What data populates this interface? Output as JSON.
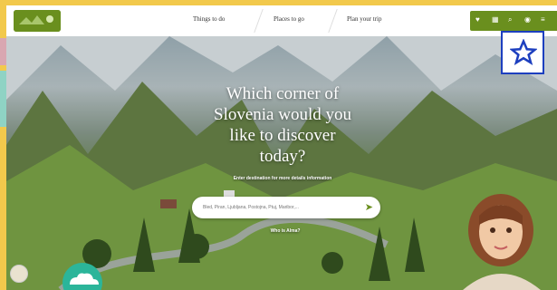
{
  "nav": {
    "links": [
      "Things to do",
      "Places to go",
      "Plan your trip"
    ]
  },
  "hero": {
    "headline_lines": [
      "Which corner of",
      "Slovenia would you",
      "like to discover",
      "today?"
    ],
    "subtitle": "Enter destination for more details information",
    "search_placeholder": "Bled, Piran, Ljubljana, Postojna, Ptuj, Maribor,...",
    "who_is_link": "Who is Alma?"
  },
  "colors": {
    "brand_green": "#6a8f1e",
    "favorite_star_blue": "#1d3fbf",
    "page_frame_yellow": "#f2c94c"
  },
  "icons": [
    "heart-icon",
    "map-icon",
    "search-icon",
    "language-icon",
    "menu-icon",
    "star-outline-icon",
    "send-icon",
    "cloud-badge-icon"
  ]
}
